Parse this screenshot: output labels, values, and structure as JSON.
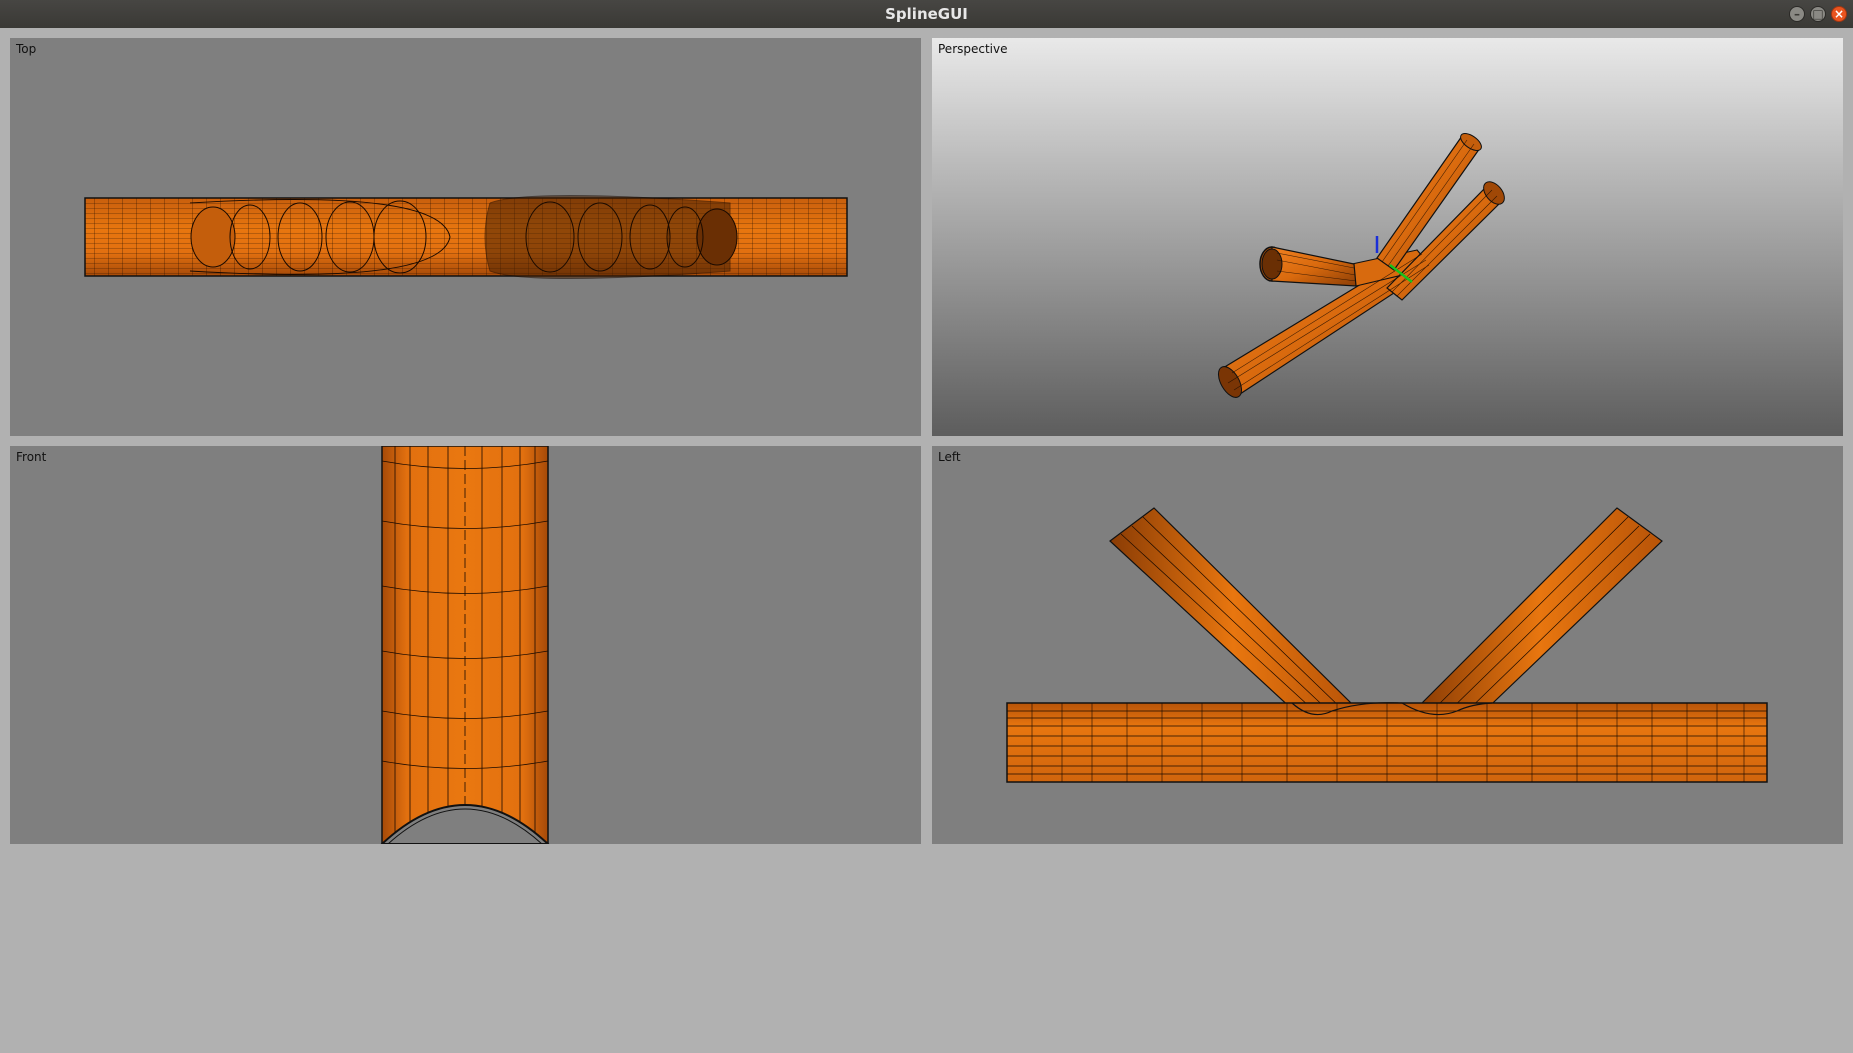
{
  "window": {
    "title": "SplineGUI",
    "controls": {
      "minimize": "–",
      "maximize": "□",
      "close": "×"
    }
  },
  "viewports": [
    {
      "label": "Top"
    },
    {
      "label": "Perspective"
    },
    {
      "label": "Front"
    },
    {
      "label": "Left"
    }
  ],
  "colors": {
    "mesh": "#e8730f",
    "mesh_dark": "#7a3505",
    "wire": "#1a0a00",
    "viewport_bg": "#7f7f7f",
    "window_bg": "#b1b1b1",
    "axis_y": "#1a2fd8",
    "axis_x": "#18c21d"
  }
}
